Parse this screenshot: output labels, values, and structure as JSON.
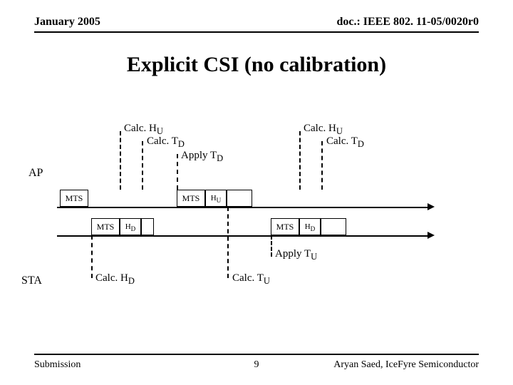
{
  "header": {
    "left": "January 2005",
    "right": "doc.: IEEE 802. 11-05/0020r0"
  },
  "title": "Explicit CSI (no calibration)",
  "row_labels": {
    "ap": "AP",
    "sta": "STA"
  },
  "annot": {
    "calc_hu_1": "Calc. H",
    "calc_td_1": "Calc. T",
    "apply_td": "Apply T",
    "calc_hu_2": "Calc. H",
    "calc_td_2": "Calc. T",
    "calc_hd": "Calc. H",
    "calc_tu": "Calc. T",
    "apply_tu": "Apply T",
    "sub_u": "U",
    "sub_d": "D"
  },
  "box": {
    "mts": "MTS",
    "hu": "H",
    "hd": "H",
    "sub_u": "U",
    "sub_d": "D"
  },
  "footer": {
    "left": "Submission",
    "page": "9",
    "right": "Aryan Saed, IceFyre Semiconductor"
  }
}
